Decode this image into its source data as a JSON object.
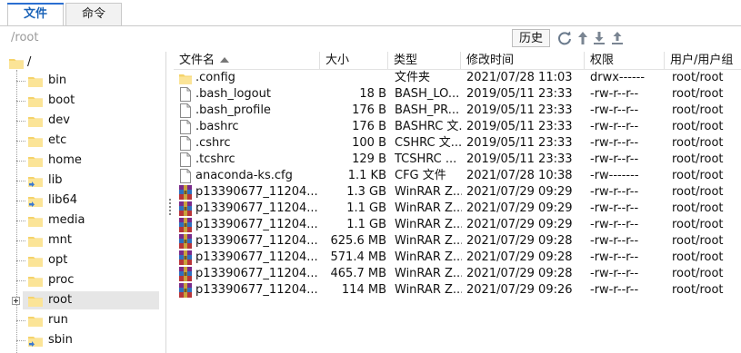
{
  "tabs": [
    {
      "label": "文件"
    },
    {
      "label": "命令"
    }
  ],
  "path": {
    "value": "/root",
    "history_label": "历史"
  },
  "toolbar_icons": [
    "refresh-icon",
    "up-directory-icon",
    "download-icon",
    "upload-icon"
  ],
  "tree": {
    "root_label": "/",
    "items": [
      {
        "label": "bin"
      },
      {
        "label": "boot"
      },
      {
        "label": "dev"
      },
      {
        "label": "etc"
      },
      {
        "label": "home"
      },
      {
        "label": "lib"
      },
      {
        "label": "lib64"
      },
      {
        "label": "media"
      },
      {
        "label": "mnt"
      },
      {
        "label": "opt"
      },
      {
        "label": "proc"
      },
      {
        "label": "root"
      },
      {
        "label": "run"
      },
      {
        "label": "sbin"
      }
    ],
    "selected": "root"
  },
  "columns": {
    "name": "文件名",
    "size": "大小",
    "type": "类型",
    "mtime": "修改时间",
    "perm": "权限",
    "owner": "用户/用户组"
  },
  "files": [
    {
      "name": ".config",
      "size": "",
      "type": "文件夹",
      "mtime": "2021/07/28 11:03",
      "perm": "drwx------",
      "owner": "root/root",
      "icon": "folder"
    },
    {
      "name": ".bash_logout",
      "size": "18 B",
      "type": "BASH_LO...",
      "mtime": "2019/05/11 23:33",
      "perm": "-rw-r--r--",
      "owner": "root/root",
      "icon": "file"
    },
    {
      "name": ".bash_profile",
      "size": "176 B",
      "type": "BASH_PR...",
      "mtime": "2019/05/11 23:33",
      "perm": "-rw-r--r--",
      "owner": "root/root",
      "icon": "file"
    },
    {
      "name": ".bashrc",
      "size": "176 B",
      "type": "BASHRC 文...",
      "mtime": "2019/05/11 23:33",
      "perm": "-rw-r--r--",
      "owner": "root/root",
      "icon": "file"
    },
    {
      "name": ".cshrc",
      "size": "100 B",
      "type": "CSHRC 文...",
      "mtime": "2019/05/11 23:33",
      "perm": "-rw-r--r--",
      "owner": "root/root",
      "icon": "file"
    },
    {
      "name": ".tcshrc",
      "size": "129 B",
      "type": "TCSHRC ...",
      "mtime": "2019/05/11 23:33",
      "perm": "-rw-r--r--",
      "owner": "root/root",
      "icon": "file"
    },
    {
      "name": "anaconda-ks.cfg",
      "size": "1.1 KB",
      "type": "CFG 文件",
      "mtime": "2021/07/28 10:38",
      "perm": "-rw-------",
      "owner": "root/root",
      "icon": "file"
    },
    {
      "name": "p13390677_11204...",
      "size": "1.3 GB",
      "type": "WinRAR Z...",
      "mtime": "2021/07/29 09:29",
      "perm": "-rw-r--r--",
      "owner": "root/root",
      "icon": "winrar"
    },
    {
      "name": "p13390677_11204...",
      "size": "1.1 GB",
      "type": "WinRAR Z...",
      "mtime": "2021/07/29 09:29",
      "perm": "-rw-r--r--",
      "owner": "root/root",
      "icon": "winrar"
    },
    {
      "name": "p13390677_11204...",
      "size": "1.1 GB",
      "type": "WinRAR Z...",
      "mtime": "2021/07/29 09:29",
      "perm": "-rw-r--r--",
      "owner": "root/root",
      "icon": "winrar"
    },
    {
      "name": "p13390677_11204...",
      "size": "625.6 MB",
      "type": "WinRAR Z...",
      "mtime": "2021/07/29 09:28",
      "perm": "-rw-r--r--",
      "owner": "root/root",
      "icon": "winrar"
    },
    {
      "name": "p13390677_11204...",
      "size": "571.4 MB",
      "type": "WinRAR Z...",
      "mtime": "2021/07/29 09:28",
      "perm": "-rw-r--r--",
      "owner": "root/root",
      "icon": "winrar"
    },
    {
      "name": "p13390677_11204...",
      "size": "465.7 MB",
      "type": "WinRAR Z...",
      "mtime": "2021/07/29 09:28",
      "perm": "-rw-r--r--",
      "owner": "root/root",
      "icon": "winrar"
    },
    {
      "name": "p13390677_11204...",
      "size": "114 MB",
      "type": "WinRAR Z...",
      "mtime": "2021/07/29 09:26",
      "perm": "-rw-r--r--",
      "owner": "root/root",
      "icon": "winrar"
    }
  ]
}
